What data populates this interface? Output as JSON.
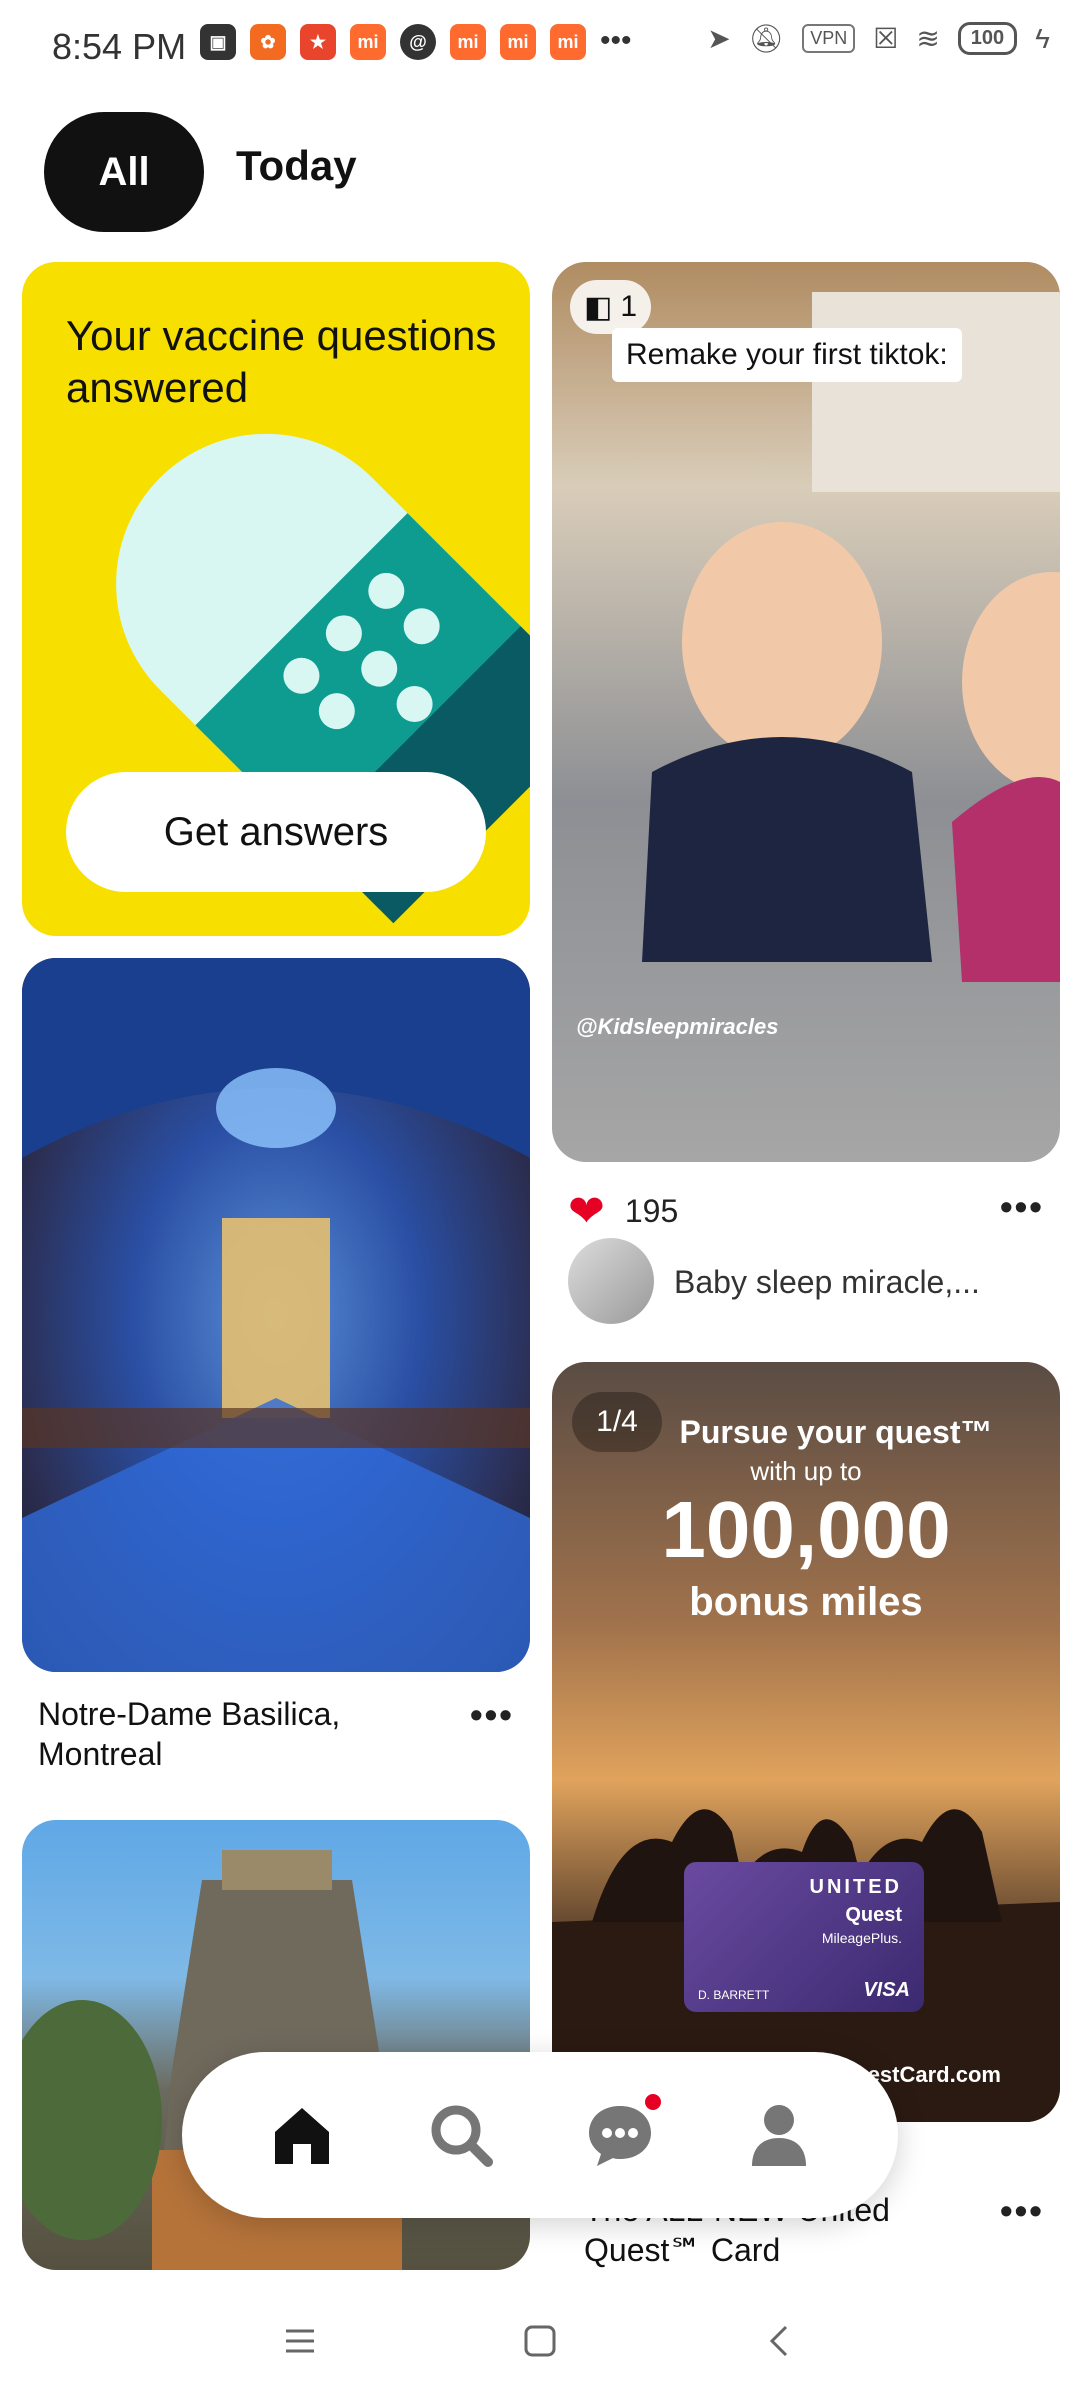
{
  "status_bar": {
    "time": "8:54 PM",
    "vpn": "VPN",
    "battery": "100"
  },
  "tabs": {
    "all": "All",
    "today": "Today"
  },
  "vaccine_card": {
    "title": "Your vaccine questions answered",
    "button": "Get answers"
  },
  "baby_pin": {
    "count": "1",
    "overlay_text": "Remake your first tiktok:",
    "credit": "@Kidsleepmiracles",
    "likes": "195",
    "author": "Baby sleep miracle,..."
  },
  "basilica_pin": {
    "caption": "Notre-Dame Basilica, Montreal"
  },
  "ad_pin": {
    "count": "1/4",
    "headline": "Pursue your quest™",
    "subline": "with up to",
    "amount": "100,000",
    "bonus": "bonus miles",
    "card_brand": "UNITED",
    "card_name": "Quest",
    "card_program": "MileagePlus.",
    "card_holder": "D. BARRETT",
    "card_network": "VISA",
    "footer": "Apply today at UnitedQuestCard.com",
    "caption": "The ALL-NEW United Quest℠ Card"
  },
  "more_label": "•••"
}
